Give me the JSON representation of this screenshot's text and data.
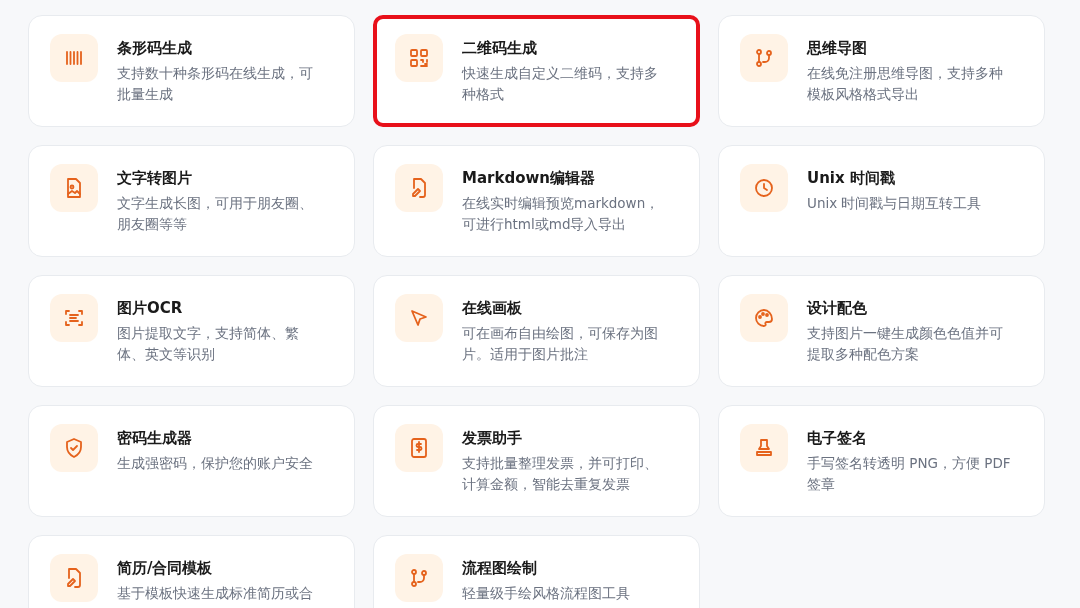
{
  "tools": [
    {
      "title": "条形码生成",
      "description": "支持数十种条形码在线生成，可批量生成",
      "selected": false
    },
    {
      "title": "二维码生成",
      "description": "快速生成自定义二维码，支持多种格式",
      "selected": true
    },
    {
      "title": "思维导图",
      "description": "在线免注册思维导图，支持多种模板风格格式导出",
      "selected": false
    },
    {
      "title": "文字转图片",
      "description": "文字生成长图，可用于朋友圈、朋友圈等等",
      "selected": false
    },
    {
      "title": "Markdown编辑器",
      "description": "在线实时编辑预览markdown，可进行html或md导入导出",
      "selected": false
    },
    {
      "title": "Unix 时间戳",
      "description": "Unix 时间戳与日期互转工具",
      "selected": false
    },
    {
      "title": "图片OCR",
      "description": "图片提取文字，支持简体、繁体、英文等识别",
      "selected": false
    },
    {
      "title": "在线画板",
      "description": "可在画布自由绘图，可保存为图片。适用于图片批注",
      "selected": false
    },
    {
      "title": "设计配色",
      "description": "支持图片一键生成颜色色值并可提取多种配色方案",
      "selected": false
    },
    {
      "title": "密码生成器",
      "description": "生成强密码，保护您的账户安全",
      "selected": false
    },
    {
      "title": "发票助手",
      "description": "支持批量整理发票，并可打印、计算金额，智能去重复发票",
      "selected": false
    },
    {
      "title": "电子签名",
      "description": "手写签名转透明 PNG，方便 PDF 签章",
      "selected": false
    },
    {
      "title": "简历/合同模板",
      "description": "基于模板快速生成标准简历或合",
      "selected": false
    },
    {
      "title": "流程图绘制",
      "description": "轻量级手绘风格流程图工具",
      "selected": false
    }
  ]
}
